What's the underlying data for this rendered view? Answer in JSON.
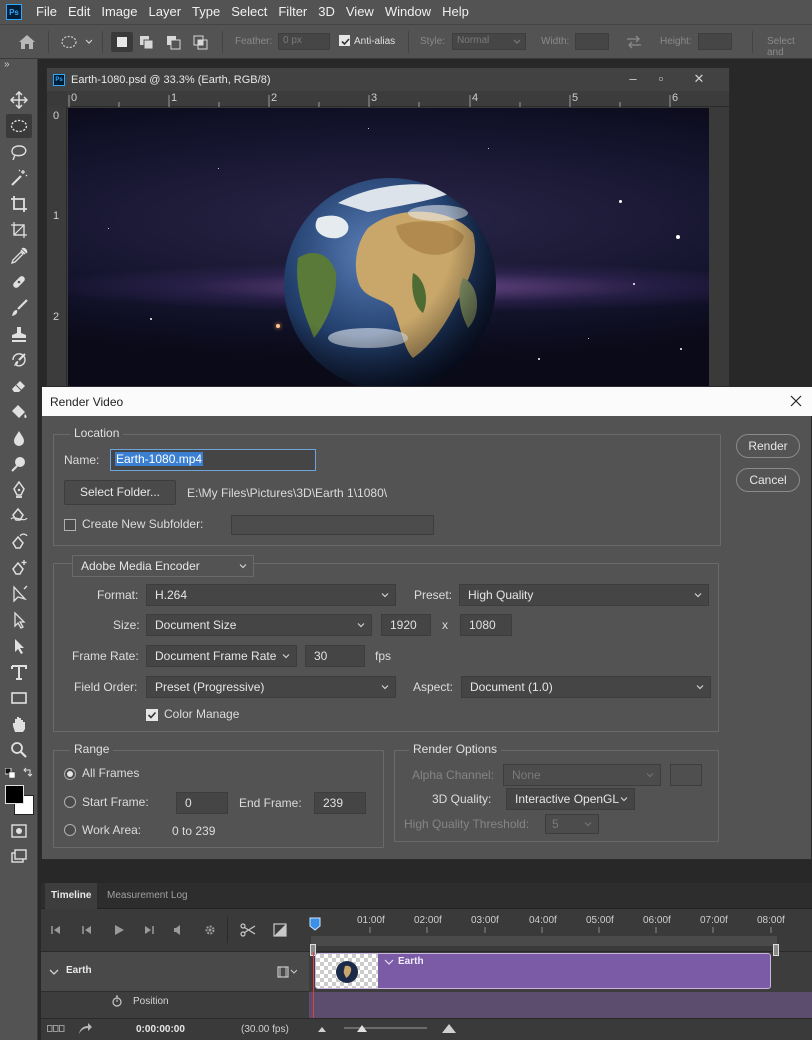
{
  "menubar": {
    "logo": "Ps",
    "items": [
      "File",
      "Edit",
      "Image",
      "Layer",
      "Type",
      "Select",
      "Filter",
      "3D",
      "View",
      "Window",
      "Help"
    ]
  },
  "optionsbar": {
    "feather_label": "Feather:",
    "feather_value": "0 px",
    "antialias_label": "Anti-alias",
    "style_label": "Style:",
    "style_value": "Normal",
    "width_label": "Width:",
    "height_label": "Height:",
    "select_mask_label": "Select and"
  },
  "toolbar": {
    "tools": [
      "move-icon",
      "elliptical-marquee-icon",
      "lasso-icon",
      "magic-wand-icon",
      "crop-icon",
      "frame-icon",
      "eyedropper-icon",
      "healing-brush-icon",
      "brush-icon",
      "clone-stamp-icon",
      "history-brush-icon",
      "eraser-icon",
      "paint-bucket-icon",
      "blur-icon",
      "dodge-icon",
      "pen-icon",
      "freeform-pen-icon",
      "curvature-pen-icon",
      "add-anchor-icon",
      "path-selection-icon",
      "direct-selection-icon",
      "type-icon",
      "rectangle-icon",
      "hand-icon",
      "zoom-icon"
    ]
  },
  "document": {
    "title": "Earth-1080.psd @ 33.3% (Earth, RGB/8)",
    "ruler_top": [
      "0",
      "1",
      "2",
      "3",
      "4",
      "5",
      "6"
    ],
    "ruler_left": [
      "0",
      "1",
      "2"
    ]
  },
  "dialog": {
    "title": "Render Video",
    "location": {
      "title": "Location",
      "name_label": "Name:",
      "name_value": "Earth-1080.mp4",
      "select_folder_label": "Select Folder...",
      "folder_path": "E:\\My Files\\Pictures\\3D\\Earth 1\\1080\\",
      "subfolder_label": "Create New Subfolder:",
      "subfolder_checked": false
    },
    "encoder": {
      "encoder_value": "Adobe Media Encoder",
      "format_label": "Format:",
      "format_value": "H.264",
      "preset_label": "Preset:",
      "preset_value": "High Quality",
      "size_label": "Size:",
      "size_value": "Document Size",
      "width_value": "1920",
      "x_label": "x",
      "height_value": "1080",
      "frame_rate_label": "Frame Rate:",
      "frame_rate_value": "Document Frame Rate",
      "fps_value": "30",
      "fps_label": "fps",
      "field_order_label": "Field Order:",
      "field_order_value": "Preset (Progressive)",
      "aspect_label": "Aspect:",
      "aspect_value": "Document (1.0)",
      "color_manage_label": "Color Manage",
      "color_manage_checked": true
    },
    "range": {
      "title": "Range",
      "all_frames_label": "All Frames",
      "start_frame_label": "Start Frame:",
      "start_frame_value": "0",
      "end_frame_label": "End Frame:",
      "end_frame_value": "239",
      "work_area_label": "Work Area:",
      "work_area_value": "0 to 239",
      "selected": "All Frames"
    },
    "render_options": {
      "title": "Render Options",
      "alpha_label": "Alpha Channel:",
      "alpha_value": "None",
      "quality_label": "3D Quality:",
      "quality_value": "Interactive OpenGL",
      "threshold_label": "High Quality Threshold:",
      "threshold_value": "5"
    },
    "buttons": {
      "render": "Render",
      "cancel": "Cancel"
    }
  },
  "timeline": {
    "tabs": [
      "Timeline",
      "Measurement Log"
    ],
    "times": [
      "01:00f",
      "02:00f",
      "03:00f",
      "04:00f",
      "05:00f",
      "06:00f",
      "07:00f",
      "08:00f"
    ],
    "track_name": "Earth",
    "sub_track": "Position",
    "clip_label": "Earth",
    "current_time": "0:00:00:00",
    "frame_rate": "(30.00 fps)"
  },
  "colors": {
    "accent": "#31a8ff",
    "clip": "#7b5aa6",
    "playhead": "#e04040"
  }
}
